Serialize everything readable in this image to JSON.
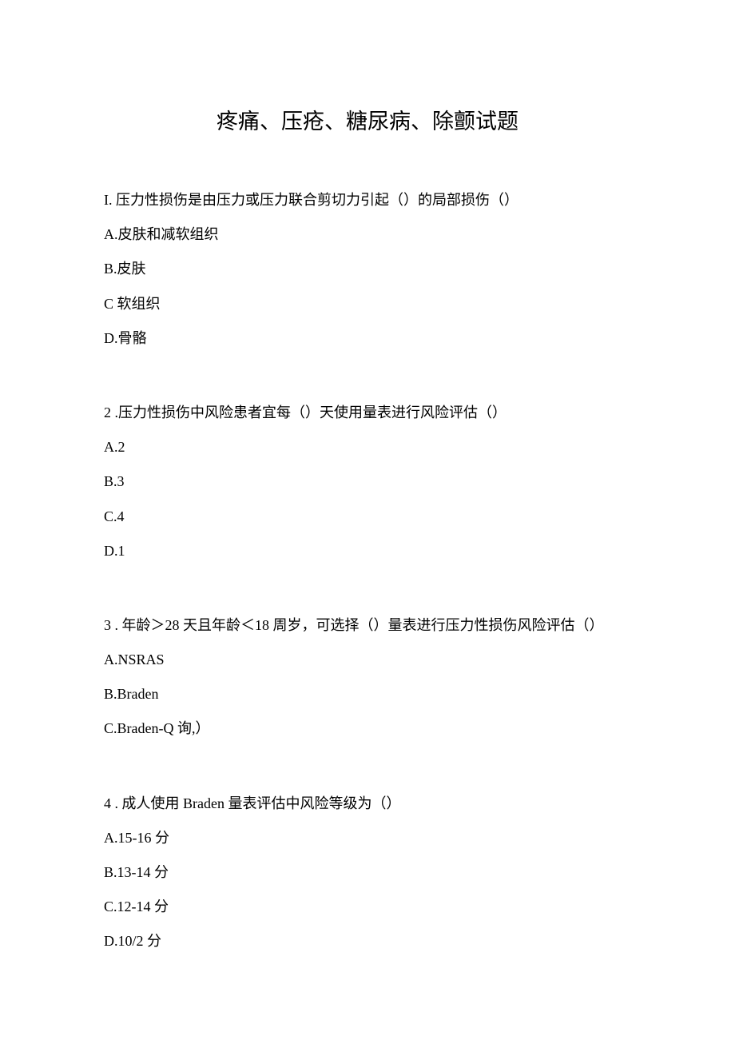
{
  "title": "疼痛、压疮、糖尿病、除颤试题",
  "questions": [
    {
      "number": "I.",
      "text": " 压力性损伤是由压力或压力联合剪切力引起（）的局部损伤（）",
      "options": [
        "A.皮肤和减软组织",
        "B.皮肤",
        "C 软组织",
        "D.骨骼"
      ]
    },
    {
      "number": "2 ",
      "text": " .压力性损伤中风险患者宜每（）天使用量表进行风险评估（）",
      "options": [
        "A.2",
        "B.3",
        "C.4",
        "D.1"
      ]
    },
    {
      "number": "3 ",
      "text": " . 年龄＞28 天且年龄＜18 周岁，可选择（）量表进行压力性损伤风险评估（）",
      "options": [
        "A.NSRAS",
        "B.Braden",
        "C.Braden-Q 询,）"
      ]
    },
    {
      "number": "4 ",
      "text": " . 成人使用 Braden 量表评估中风险等级为（）",
      "options": [
        "A.15-16 分",
        "B.13-14 分",
        "C.12-14 分",
        "D.10/2 分"
      ]
    }
  ]
}
